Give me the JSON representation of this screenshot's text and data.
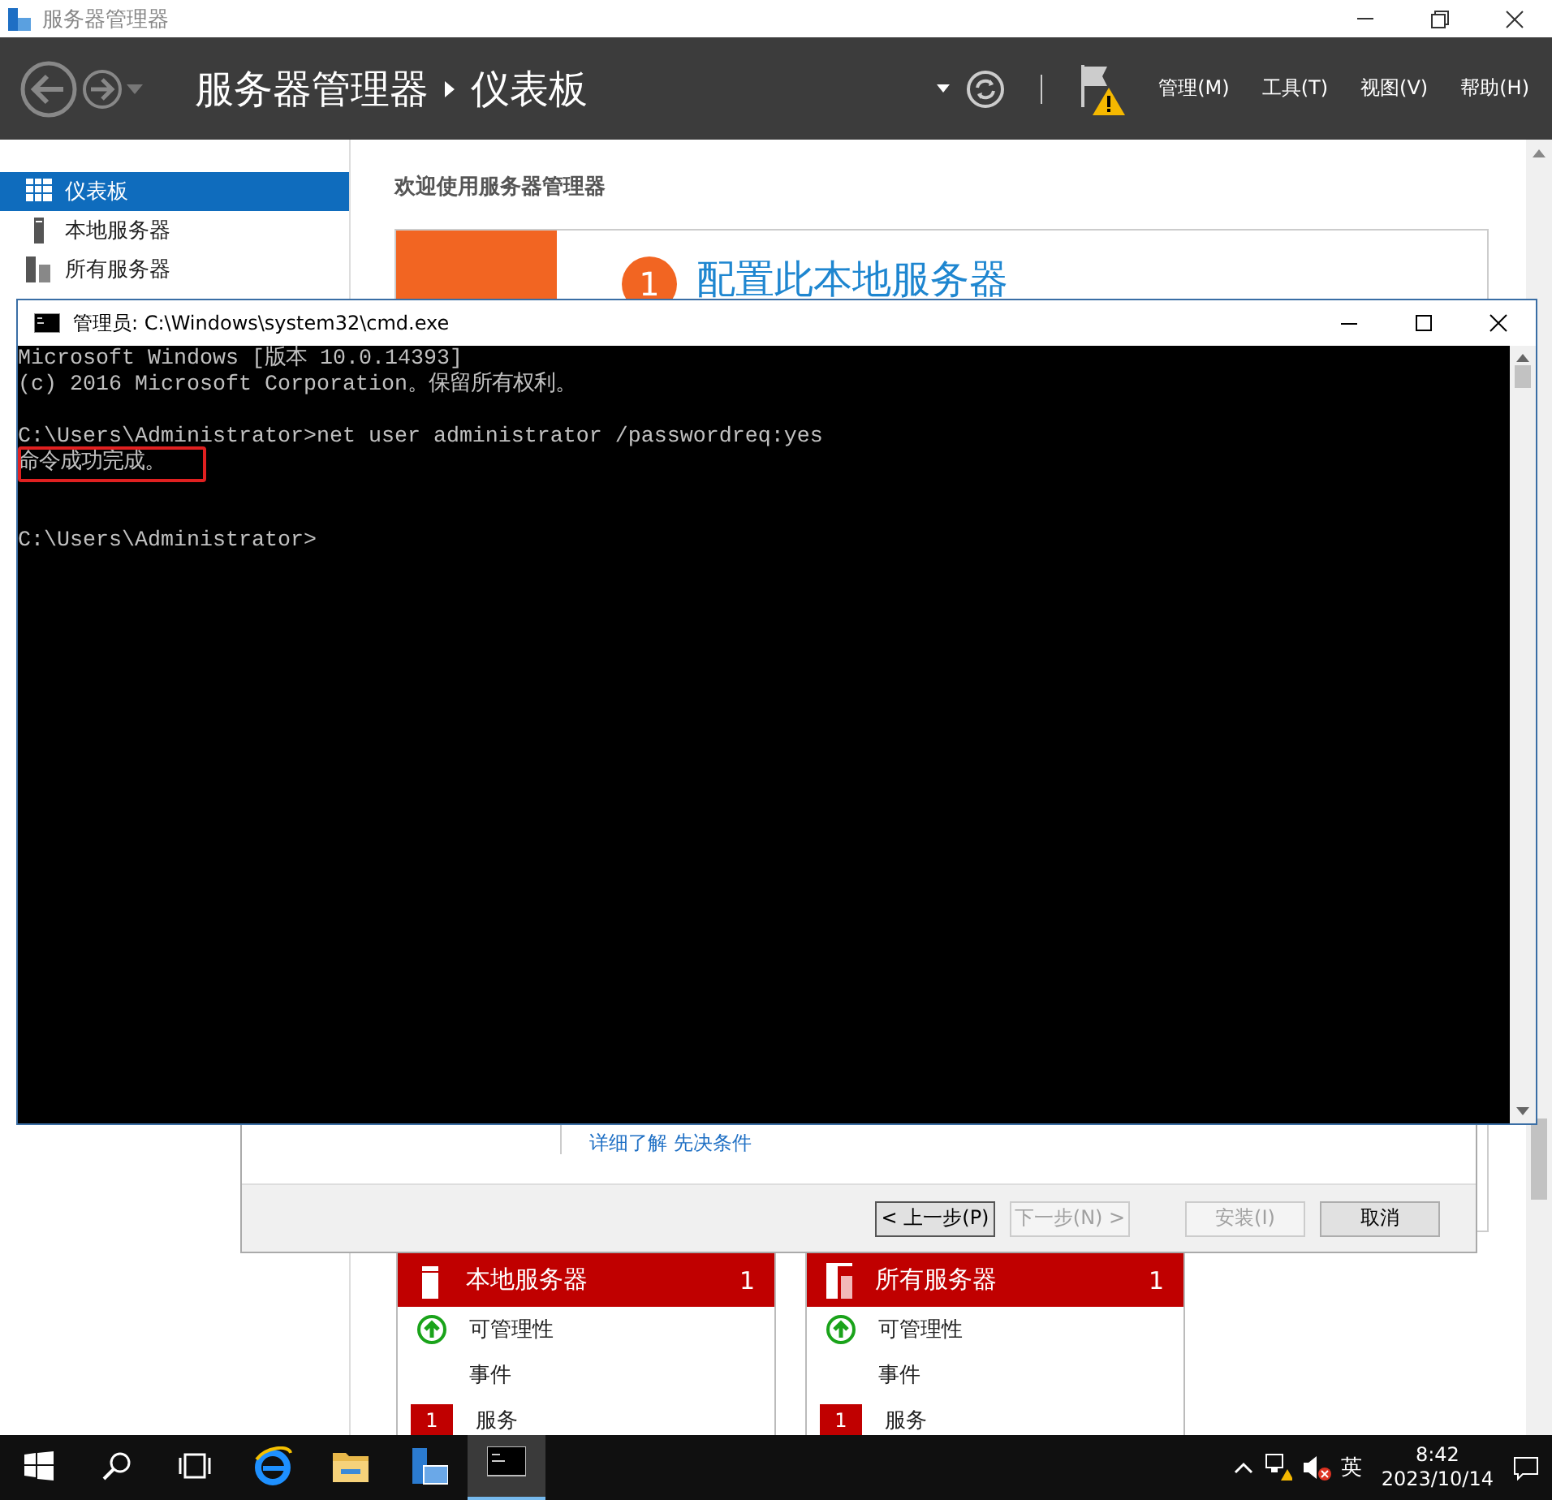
{
  "app_window": {
    "title": "服务器管理器"
  },
  "header": {
    "breadcrumb": [
      "服务器管理器",
      "仪表板"
    ],
    "menus": [
      "管理(M)",
      "工具(T)",
      "视图(V)",
      "帮助(H)"
    ]
  },
  "sidebar": {
    "items": [
      {
        "label": "仪表板",
        "selected": true,
        "kind": "dashboard"
      },
      {
        "label": "本地服务器",
        "selected": false,
        "kind": "server"
      },
      {
        "label": "所有服务器",
        "selected": false,
        "kind": "servers"
      }
    ]
  },
  "welcome": {
    "heading": "欢迎使用服务器管理器",
    "step_number": "1",
    "step_title": "配置此本地服务器"
  },
  "wizard": {
    "links": [
      "详细了解",
      "先决条件"
    ],
    "buttons": [
      {
        "label": "< 上一步(P)",
        "disabled": false
      },
      {
        "label": "下一步(N) >",
        "disabled": true
      },
      {
        "label": "安装(I)",
        "disabled": true
      },
      {
        "label": "取消",
        "disabled": false
      }
    ]
  },
  "tiles": [
    {
      "title": "本地服务器",
      "count": "1",
      "kind": "server",
      "rows": [
        {
          "label": "可管理性",
          "kind": "ok"
        },
        {
          "label": "事件",
          "kind": "plain"
        },
        {
          "label": "服务",
          "kind": "alert",
          "badge": "1"
        }
      ]
    },
    {
      "title": "所有服务器",
      "count": "1",
      "kind": "servers",
      "rows": [
        {
          "label": "可管理性",
          "kind": "ok"
        },
        {
          "label": "事件",
          "kind": "plain"
        },
        {
          "label": "服务",
          "kind": "alert",
          "badge": "1"
        }
      ]
    }
  ],
  "console_window": {
    "title": "管理员: C:\\Windows\\system32\\cmd.exe",
    "lines": [
      {
        "kind": "text",
        "text": "Microsoft Windows [版本 10.0.14393]",
        "marked": false
      },
      {
        "kind": "text",
        "text": "(c) 2016 Microsoft Corporation。保留所有权利。",
        "marked": false
      },
      {
        "kind": "blank"
      },
      {
        "kind": "text",
        "text": "C:\\Users\\Administrator>net user administrator /passwordreq:yes",
        "marked": false
      },
      {
        "kind": "text",
        "text": "命令成功完成。",
        "marked": true
      },
      {
        "kind": "blank"
      },
      {
        "kind": "blank"
      },
      {
        "kind": "text",
        "text": "C:\\Users\\Administrator>",
        "marked": false
      }
    ]
  },
  "taskbar": {
    "apps": [
      {
        "kind": "browser",
        "active": false
      },
      {
        "kind": "folder",
        "active": false
      },
      {
        "kind": "server-manager",
        "active": false
      },
      {
        "kind": "console",
        "active": true
      }
    ],
    "ime": "英",
    "time": "8:42",
    "date": "2023/10/14"
  }
}
